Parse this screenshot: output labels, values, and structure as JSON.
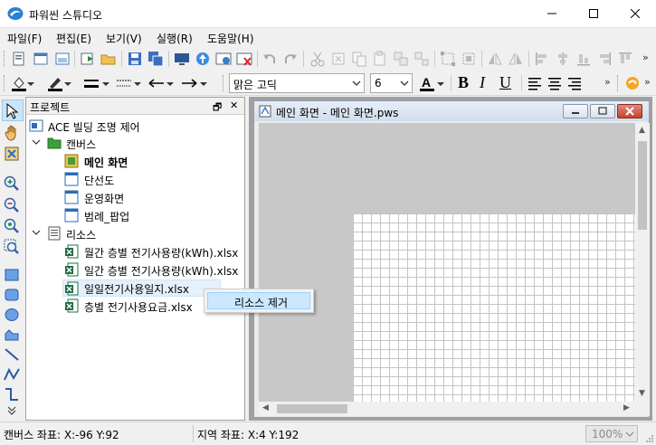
{
  "window": {
    "title": "파워씬 스튜디오",
    "accent": "#1e6fd9"
  },
  "menu": {
    "items": [
      "파일(F)",
      "편집(E)",
      "보기(V)",
      "실행(R)",
      "도움말(H)"
    ]
  },
  "format_toolbar": {
    "font_name": "맑은 고딕",
    "font_size": "6",
    "bold": "B",
    "italic": "I",
    "underline": "U"
  },
  "project_panel": {
    "title": "프로젝트",
    "pin_glyph": "🗗",
    "close_glyph": "✕",
    "root": "ACE 빌딩 조명 제어",
    "canvas_group": "캔버스",
    "canvases": [
      "메인 화면",
      "단선도",
      "운영화면",
      "범례_팝업"
    ],
    "resource_group": "리소스",
    "resources": [
      "월간 층별 전기사용량(kWh).xlsx",
      "일간 층별 전기사용량(kWh).xlsx",
      "일일전기사용일지.xlsx",
      "층별 전기사용요금.xlsx"
    ]
  },
  "context_menu": {
    "remove_resource": "리소스 제거"
  },
  "child_window": {
    "title": "메인 화면 - 메인 화면.pws"
  },
  "status": {
    "canvas_coords": "캔버스 좌표: X:-96 Y:92",
    "local_coords": "지역 좌표: X:4 Y:192",
    "zoom": "100%"
  }
}
